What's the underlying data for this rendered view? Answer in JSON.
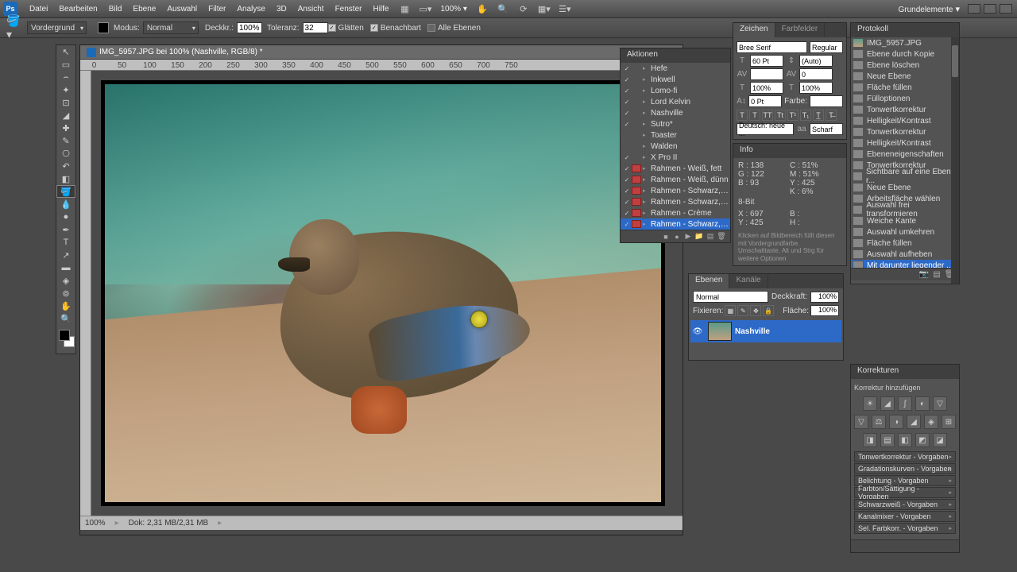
{
  "menubar": {
    "items": [
      "Datei",
      "Bearbeiten",
      "Bild",
      "Ebene",
      "Auswahl",
      "Filter",
      "Analyse",
      "3D",
      "Ansicht",
      "Fenster",
      "Hilfe"
    ],
    "zoom": "100%",
    "workspace": "Grundelemente"
  },
  "optbar": {
    "vg": "Vordergrund",
    "modus_lbl": "Modus:",
    "modus": "Normal",
    "deckkr_lbl": "Deckkr.:",
    "deckkr": "100%",
    "toleranz_lbl": "Toleranz:",
    "toleranz": "32",
    "glaetten": "Glätten",
    "benachbart": "Benachbart",
    "alle": "Alle Ebenen"
  },
  "doc": {
    "title": "IMG_5957.JPG bei 100% (Nashville, RGB/8) *",
    "rulers": [
      "0",
      "50",
      "100",
      "150",
      "200",
      "250",
      "300",
      "350",
      "400",
      "450",
      "500",
      "550",
      "600",
      "650",
      "700",
      "750"
    ],
    "status_zoom": "100%",
    "status_size": "Dok: 2,31 MB/2,31 MB"
  },
  "aktionen": {
    "title": "Aktionen",
    "items": [
      {
        "n": "Hefe",
        "c": true
      },
      {
        "n": "Inkwell",
        "c": true
      },
      {
        "n": "Lomo-fi",
        "c": true
      },
      {
        "n": "Lord Kelvin",
        "c": true
      },
      {
        "n": "Nashville",
        "c": true
      },
      {
        "n": "Sutro*",
        "c": true
      },
      {
        "n": "Toaster",
        "c": false
      },
      {
        "n": "Walden",
        "c": false
      },
      {
        "n": "X Pro II",
        "c": true
      },
      {
        "n": "Rahmen - Weiß, fett",
        "c": true,
        "m": true
      },
      {
        "n": "Rahmen - Weiß, dünn",
        "c": true,
        "m": true
      },
      {
        "n": "Rahmen - Schwarz, fett",
        "c": true,
        "m": true
      },
      {
        "n": "Rahmen - Schwarz, d...",
        "c": true,
        "m": true
      },
      {
        "n": "Rahmen - Crème",
        "c": true,
        "m": true
      },
      {
        "n": "Rahmen - Schwarz, ...",
        "c": true,
        "m": true,
        "sel": true
      }
    ]
  },
  "zeichen": {
    "tabs": [
      "Zeichen",
      "Farbfelder"
    ],
    "font": "Bree Serif",
    "style": "Regular",
    "size": "60 Pt",
    "leading": "(Auto)",
    "kerning": "",
    "tracking": "0",
    "vscale": "100%",
    "hscale": "100%",
    "baseline": "0 Pt",
    "farbe_lbl": "Farbe:",
    "lang": "Deutsch: neue ...",
    "aa": "Scharf"
  },
  "info": {
    "title": "Info",
    "r": "138",
    "g": "122",
    "b": "93",
    "c": "51%",
    "m": "51%",
    "y": "425",
    "k": "6%",
    "bit": "8-Bit",
    "x": "697",
    "hint": "Klicken auf Bildbereich füllt diesen mit Vordergrundfarbe. Umschalttaste, Alt und Strg für weitere Optionen"
  },
  "protokoll": {
    "title": "Protokoll",
    "items": [
      "IMG_5957.JPG",
      "Ebene durch Kopie",
      "Ebene löschen",
      "Neue Ebene",
      "Fläche füllen",
      "Fülloptionen",
      "Tonwertkorrektur",
      "Helligkeit/Kontrast",
      "Tonwertkorrektur",
      "Helligkeit/Kontrast",
      "Ebeneneigenschaften",
      "Tonwertkorrektur",
      "Sichtbare auf eine Ebene r...",
      "Neue Ebene",
      "Arbeitsfläche wählen",
      "Auswahl frei transformieren",
      "Weiche Kante",
      "Auswahl umkehren",
      "Fläche füllen",
      "Auswahl aufheben",
      "Mit darunter liegender ..."
    ]
  },
  "ebenen": {
    "tabs": [
      "Ebenen",
      "Kanäle"
    ],
    "mode": "Normal",
    "deckkr_lbl": "Deckkraft:",
    "deckkr": "100%",
    "fixieren_lbl": "Fixieren:",
    "flaeche_lbl": "Fläche:",
    "flaeche": "100%",
    "layer": "Nashville"
  },
  "korrekturen": {
    "title": "Korrekturen",
    "add": "Korrektur hinzufügen",
    "presets": [
      "Tonwertkorrektur - Vorgaben",
      "Gradationskurven - Vorgaben",
      "Belichtung - Vorgaben",
      "Farbton/Sättigung - Vorgaben",
      "Schwarzweiß - Vorgaben",
      "Kanalmixer - Vorgaben",
      "Sel. Farbkorr. - Vorgaben"
    ]
  }
}
